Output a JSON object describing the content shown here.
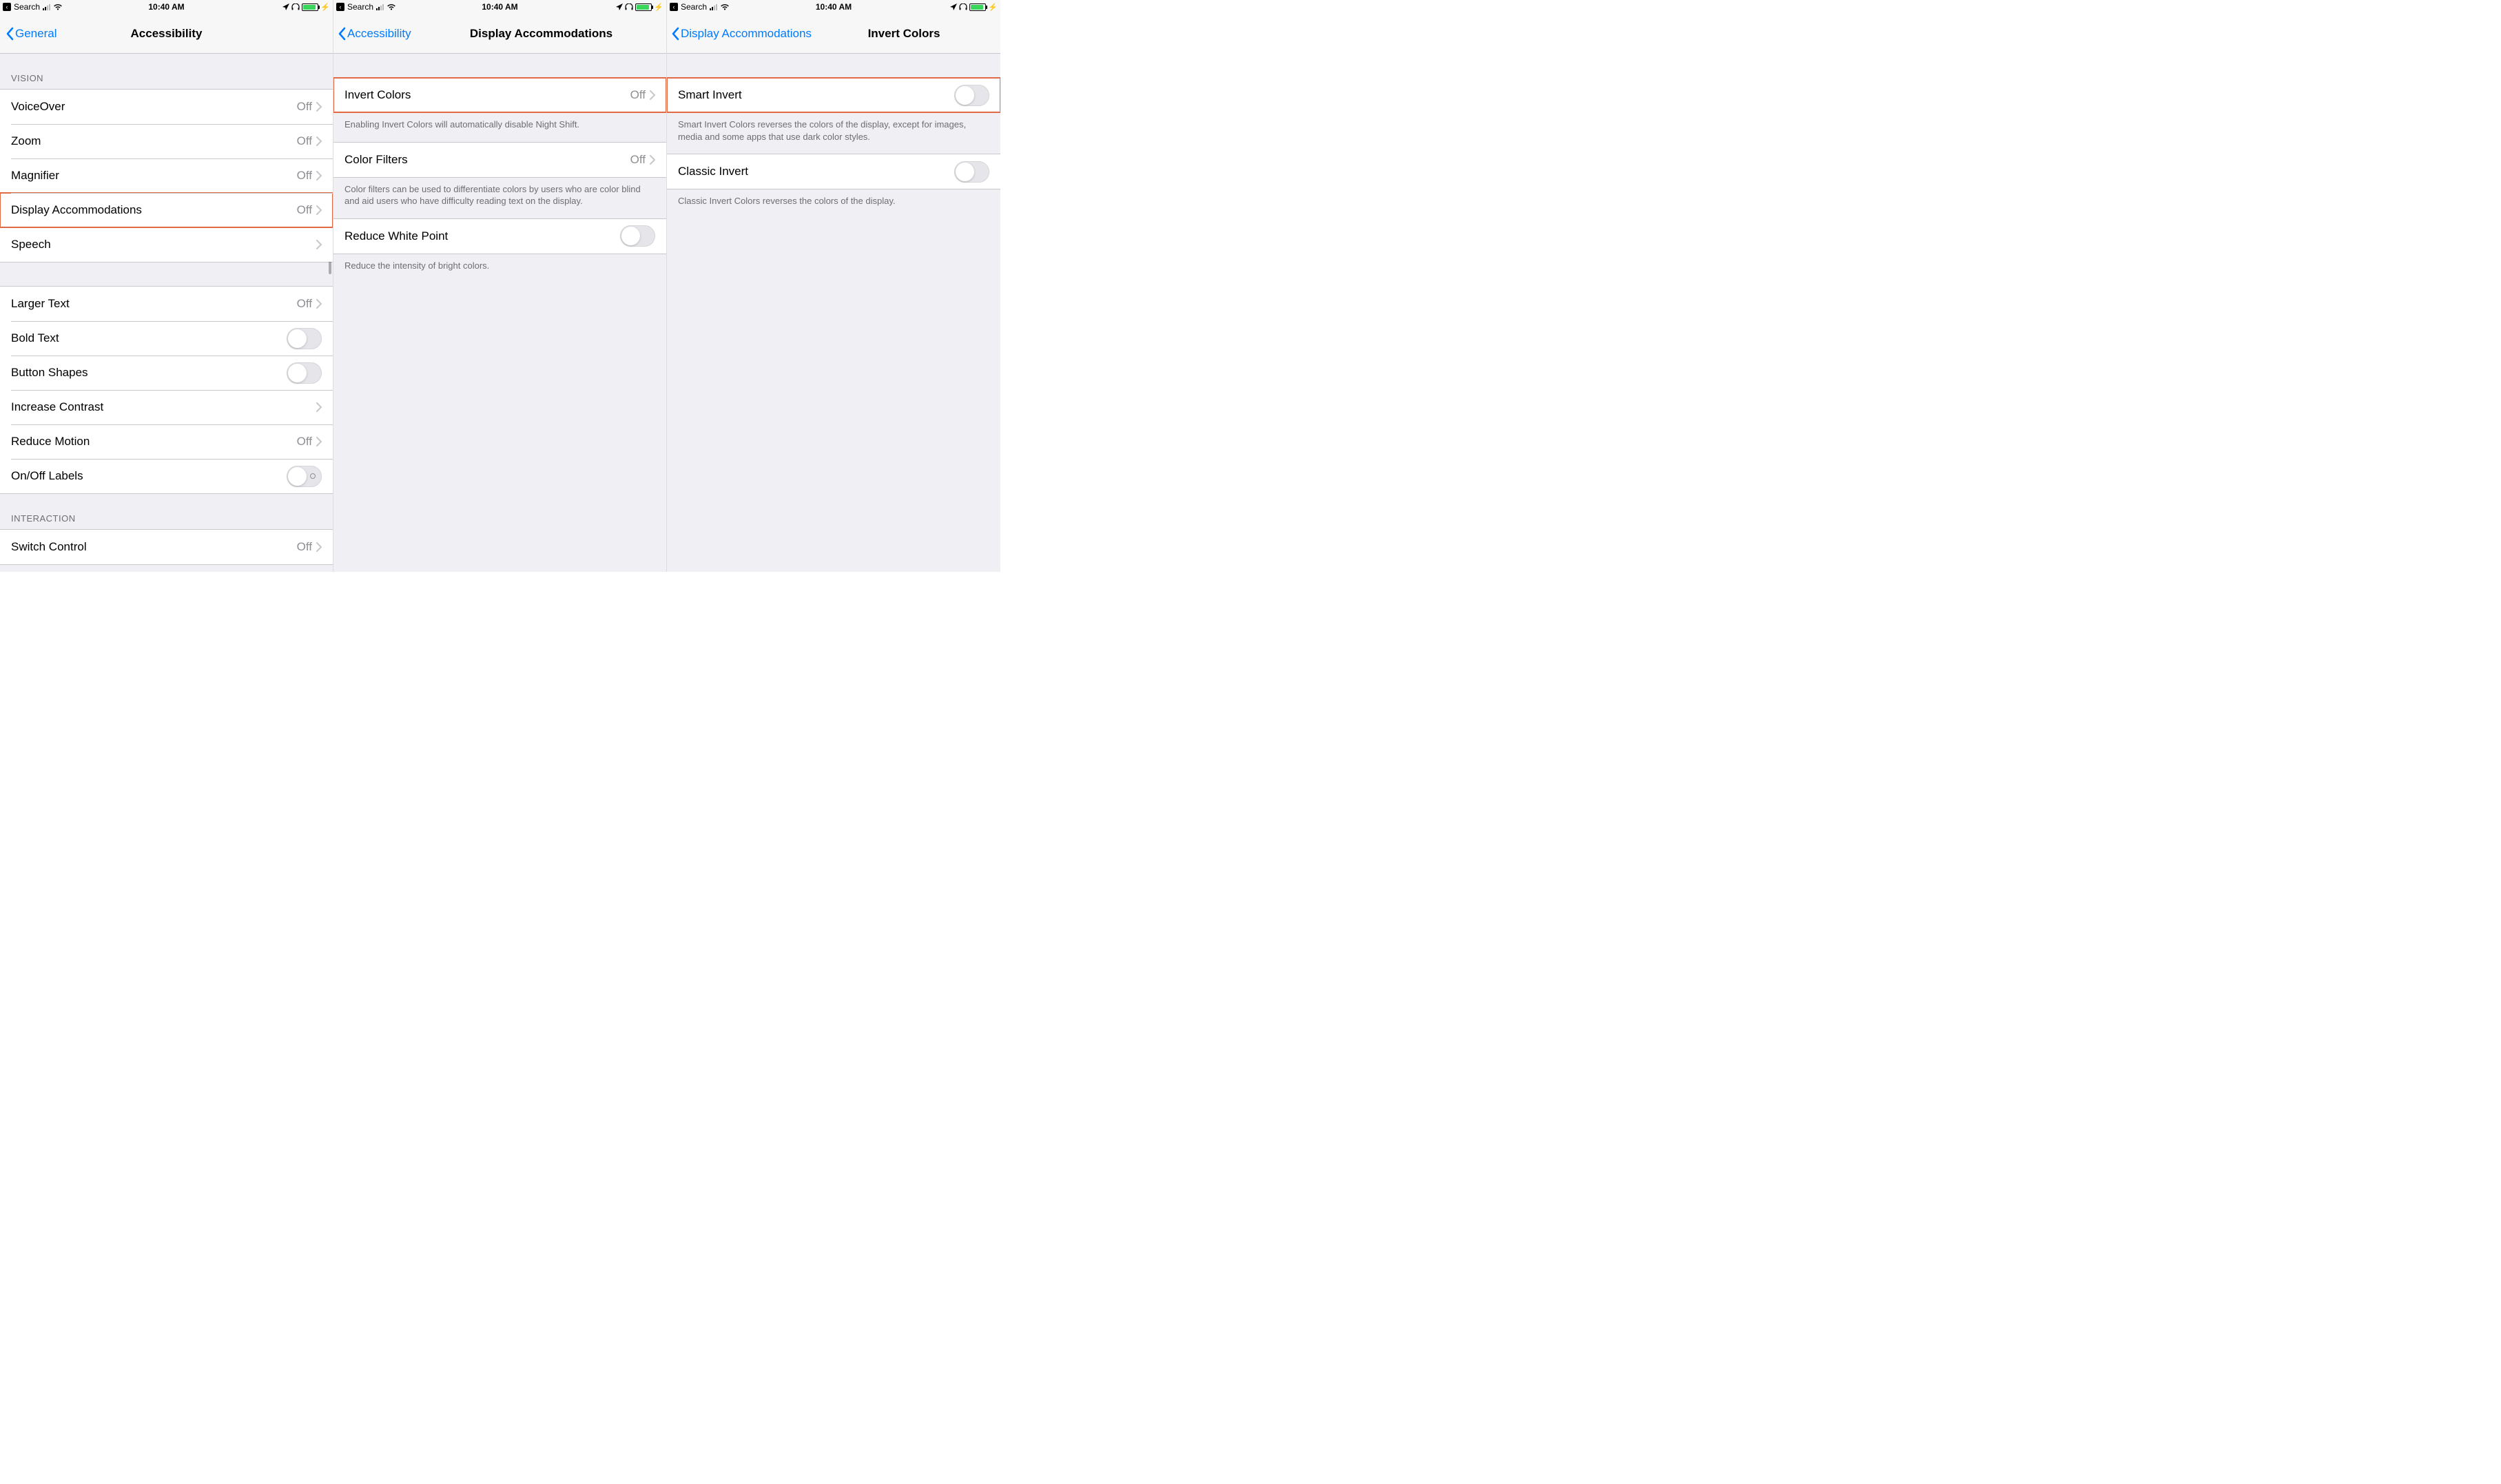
{
  "status_bar": {
    "back_to": "Search",
    "time": "10:40 AM"
  },
  "screen1": {
    "back_label": "General",
    "title": "Accessibility",
    "groups": {
      "vision_header": "VISION",
      "interaction_header": "INTERACTION"
    },
    "rows": {
      "voiceover": {
        "label": "VoiceOver",
        "value": "Off"
      },
      "zoom": {
        "label": "Zoom",
        "value": "Off"
      },
      "magnifier": {
        "label": "Magnifier",
        "value": "Off"
      },
      "display_accommodations": {
        "label": "Display Accommodations",
        "value": "Off"
      },
      "speech": {
        "label": "Speech"
      },
      "larger_text": {
        "label": "Larger Text",
        "value": "Off"
      },
      "bold_text": {
        "label": "Bold Text"
      },
      "button_shapes": {
        "label": "Button Shapes"
      },
      "increase_contrast": {
        "label": "Increase Contrast"
      },
      "reduce_motion": {
        "label": "Reduce Motion",
        "value": "Off"
      },
      "onoff_labels": {
        "label": "On/Off Labels"
      },
      "switch_control": {
        "label": "Switch Control",
        "value": "Off"
      }
    }
  },
  "screen2": {
    "back_label": "Accessibility",
    "title": "Display Accommodations",
    "rows": {
      "invert_colors": {
        "label": "Invert Colors",
        "value": "Off"
      },
      "color_filters": {
        "label": "Color Filters",
        "value": "Off"
      },
      "reduce_white_point": {
        "label": "Reduce White Point"
      }
    },
    "footers": {
      "invert": "Enabling Invert Colors will automatically disable Night Shift.",
      "color_filters": "Color filters can be used to differentiate colors by users who are color blind and aid users who have difficulty reading text on the display.",
      "reduce_white_point": "Reduce the intensity of bright colors."
    }
  },
  "screen3": {
    "back_label": "Display Accommodations",
    "title": "Invert Colors",
    "rows": {
      "smart_invert": {
        "label": "Smart Invert"
      },
      "classic_invert": {
        "label": "Classic Invert"
      }
    },
    "footers": {
      "smart": "Smart Invert Colors reverses the colors of the display, except for images, media and some apps that use dark color styles.",
      "classic": "Classic Invert Colors reverses the colors of the display."
    }
  }
}
